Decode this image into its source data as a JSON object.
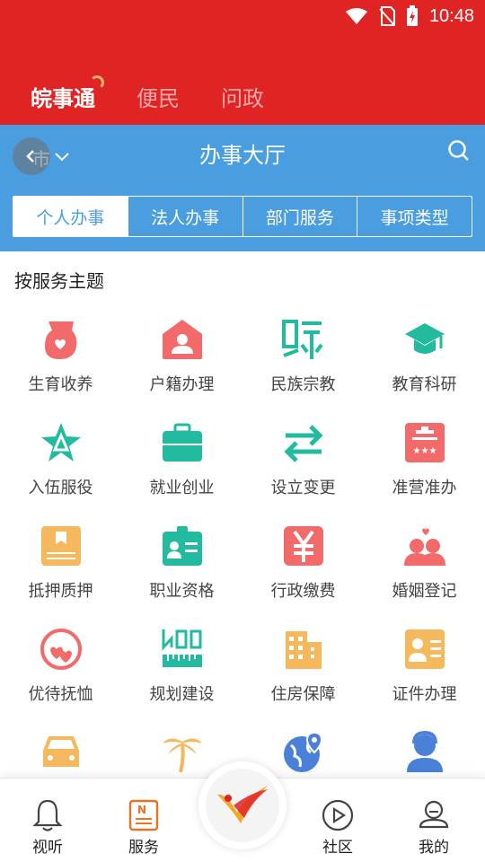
{
  "status": {
    "time": "10:48"
  },
  "top_tabs": [
    "皖事通",
    "便民",
    "问政"
  ],
  "header": {
    "city": "市",
    "title": "办事大厅"
  },
  "segments": [
    "个人办事",
    "法人办事",
    "部门服务",
    "事项类型"
  ],
  "section_title": "按服务主题",
  "services": [
    {
      "label": "生育收养",
      "icon": "maternity-icon",
      "color": "#f26a6a"
    },
    {
      "label": "户籍办理",
      "icon": "household-icon",
      "color": "#f26a6a"
    },
    {
      "label": "民族宗教",
      "icon": "ethnic-religion-icon",
      "color": "#22bba0"
    },
    {
      "label": "教育科研",
      "icon": "education-cap-icon",
      "color": "#22bba0"
    },
    {
      "label": "入伍服役",
      "icon": "military-star-icon",
      "color": "#22bba0"
    },
    {
      "label": "就业创业",
      "icon": "briefcase-icon",
      "color": "#22bba0"
    },
    {
      "label": "设立变更",
      "icon": "exchange-arrows-icon",
      "color": "#22bba0"
    },
    {
      "label": "准营准办",
      "icon": "license-icon",
      "color": "#f26a6a"
    },
    {
      "label": "抵押质押",
      "icon": "mortgage-book-icon",
      "color": "#f5b85c"
    },
    {
      "label": "职业资格",
      "icon": "id-badge-icon",
      "color": "#22bba0"
    },
    {
      "label": "行政缴费",
      "icon": "yuan-payment-icon",
      "color": "#f26a6a"
    },
    {
      "label": "婚姻登记",
      "icon": "couple-heart-icon",
      "color": "#f26a6a"
    },
    {
      "label": "优待抚恤",
      "icon": "heart-care-icon",
      "color": "#f26a6a"
    },
    {
      "label": "规划建设",
      "icon": "planning-ruler-icon",
      "color": "#22bba0"
    },
    {
      "label": "住房保障",
      "icon": "building-icon",
      "color": "#f5b85c"
    },
    {
      "label": "证件办理",
      "icon": "id-card-icon",
      "color": "#f5b85c"
    },
    {
      "label": "",
      "icon": "car-icon",
      "color": "#f5b85c"
    },
    {
      "label": "",
      "icon": "palm-island-icon",
      "color": "#f5b85c"
    },
    {
      "label": "",
      "icon": "globe-location-icon",
      "color": "#4a80d8"
    },
    {
      "label": "",
      "icon": "customer-service-icon",
      "color": "#4a80d8"
    }
  ],
  "bottom_nav": [
    {
      "label": "视听",
      "icon": "bell-icon",
      "active": false
    },
    {
      "label": "服务",
      "icon": "news-doc-icon",
      "active": true
    },
    {
      "label": "社区",
      "icon": "play-circle-icon",
      "active": false
    },
    {
      "label": "我的",
      "icon": "user-profile-icon",
      "active": false
    }
  ],
  "center_button": {
    "icon": "app-logo-icon"
  }
}
